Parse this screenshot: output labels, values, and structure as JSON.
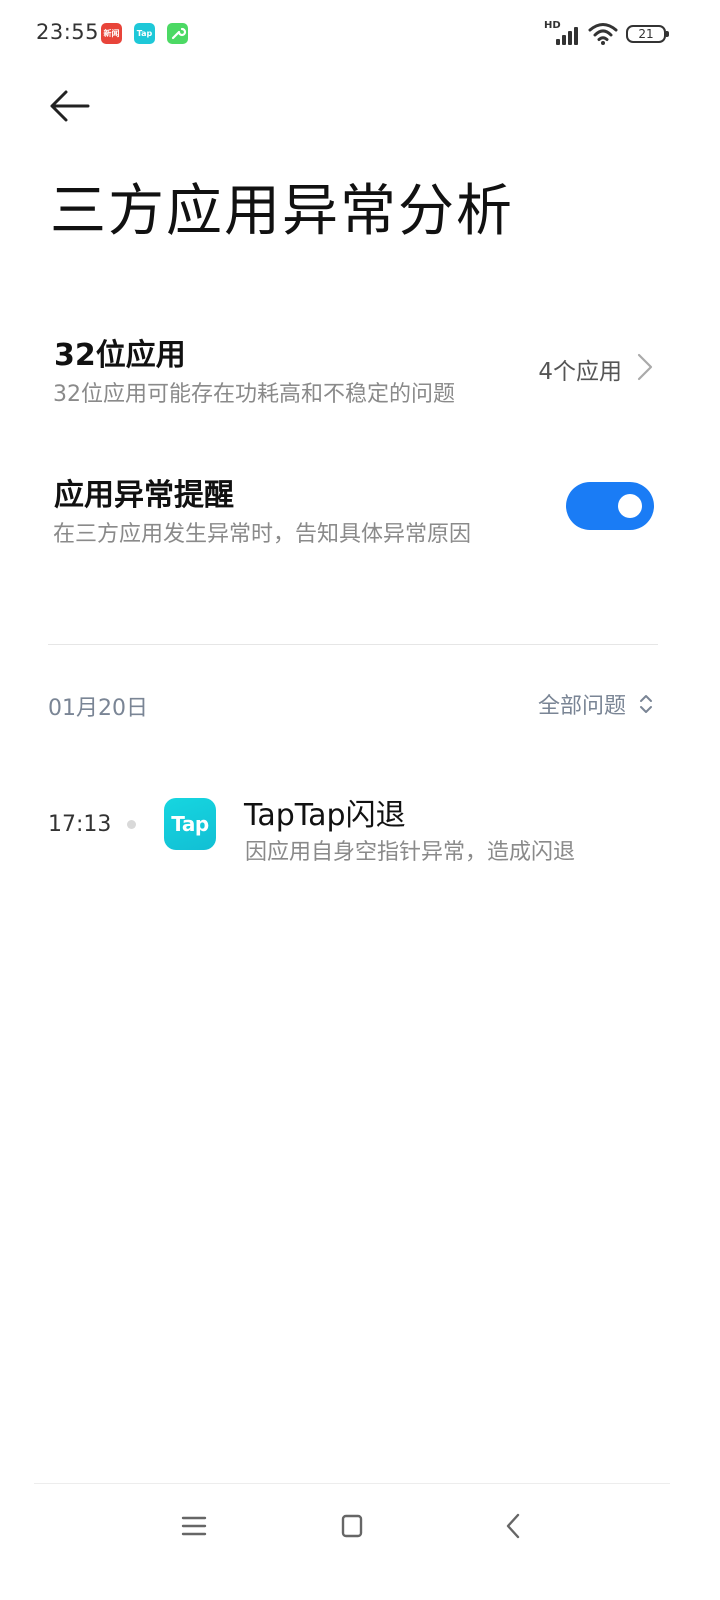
{
  "status_bar": {
    "time": "23:55",
    "notifications": [
      {
        "icon": "news-app-icon",
        "label": "新闻",
        "color": "#e8443a"
      },
      {
        "icon": "taptap-notification-icon",
        "label": "Tap",
        "color": "#1ec8d8"
      },
      {
        "icon": "tool-app-icon",
        "label": "",
        "color": "#4cd964"
      }
    ],
    "network_label": "HD",
    "battery_level": "21"
  },
  "header": {
    "title": "三方应用异常分析"
  },
  "settings": {
    "apps_32bit": {
      "title": "32位应用",
      "subtitle": "32位应用可能存在功耗高和不稳定的问题",
      "value": "4个应用"
    },
    "abnormal_alert": {
      "title": "应用异常提醒",
      "subtitle": "在三方应用发生异常时，告知具体异常原因",
      "enabled": true,
      "toggle_color": "#1a7cf5"
    }
  },
  "log": {
    "date": "01月20日",
    "filter_label": "全部问题",
    "events": [
      {
        "time": "17:13",
        "app_icon_text": "Tap",
        "title": "TapTap闪退",
        "description": "因应用自身空指针异常，造成闪退"
      }
    ]
  },
  "nav_bar": {
    "buttons": [
      "menu-icon",
      "home-icon",
      "back-icon"
    ]
  }
}
